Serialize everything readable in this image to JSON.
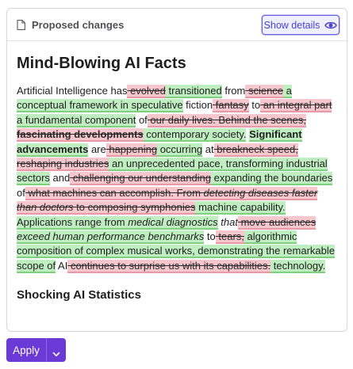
{
  "header": {
    "title": "Proposed changes",
    "show_details_label": "Show details"
  },
  "document": {
    "title": "Mind-Blowing AI Facts",
    "segments": [
      {
        "text": "Artificial Intelligence has",
        "kind": "plain"
      },
      {
        "text": " evolved",
        "kind": "del"
      },
      {
        "text": " transitioned",
        "kind": "ins"
      },
      {
        "text": " from",
        "kind": "plain"
      },
      {
        "text": " science",
        "kind": "del"
      },
      {
        "text": " a conceptual framework in speculative",
        "kind": "ins"
      },
      {
        "text": " fiction",
        "kind": "plain"
      },
      {
        "text": " fantasy",
        "kind": "del"
      },
      {
        "text": " to",
        "kind": "plain"
      },
      {
        "text": " an integral part",
        "kind": "del"
      },
      {
        "text": " a fundamental component",
        "kind": "ins"
      },
      {
        "text": " of",
        "kind": "plain"
      },
      {
        "text": " our daily lives. Behind the scenes, ",
        "kind": "del"
      },
      {
        "text": "fascinating developments",
        "kind": "del",
        "style": "b"
      },
      {
        "text": " contemporary society.",
        "kind": "ins"
      },
      {
        "text": " ",
        "kind": "plain"
      },
      {
        "text": "Significant advancements",
        "kind": "ins",
        "style": "b"
      },
      {
        "text": " are",
        "kind": "plain"
      },
      {
        "text": " happening",
        "kind": "del"
      },
      {
        "text": " occurring",
        "kind": "ins"
      },
      {
        "text": " at",
        "kind": "plain"
      },
      {
        "text": " breakneck speed, reshaping industries",
        "kind": "del"
      },
      {
        "text": " an unprecedented pace, transforming industrial sectors",
        "kind": "ins"
      },
      {
        "text": " and",
        "kind": "plain"
      },
      {
        "text": " challenging our understanding",
        "kind": "del"
      },
      {
        "text": " expanding the boundaries",
        "kind": "ins"
      },
      {
        "text": " of",
        "kind": "plain"
      },
      {
        "text": " what machines can accomplish. From ",
        "kind": "del"
      },
      {
        "text": "detecting diseases faster than doctors",
        "kind": "del",
        "style": "i"
      },
      {
        "text": " to composing symphonies",
        "kind": "del"
      },
      {
        "text": " machine capability. Applications range from ",
        "kind": "ins"
      },
      {
        "text": "medical diagnostics",
        "kind": "ins",
        "style": "i"
      },
      {
        "text": " ",
        "kind": "plain"
      },
      {
        "text": "that",
        "kind": "plain",
        "style": "i"
      },
      {
        "text": " move audiences",
        "kind": "del"
      },
      {
        "text": " ",
        "kind": "plain"
      },
      {
        "text": "exceed human performance benchmarks",
        "kind": "ins",
        "style": "i"
      },
      {
        "text": " to",
        "kind": "plain"
      },
      {
        "text": " tears,",
        "kind": "del"
      },
      {
        "text": " algorithmic composition of complex musical works, demonstrating the remarkable scope of",
        "kind": "ins"
      },
      {
        "text": " AI",
        "kind": "plain"
      },
      {
        "text": " continues to surprise us with its capabilities.",
        "kind": "del"
      },
      {
        "text": " technology.",
        "kind": "ins"
      }
    ],
    "subheading": "Shocking AI Statistics"
  },
  "footer": {
    "apply_label": "Apply"
  },
  "colors": {
    "accent": "#6b39d6",
    "insert_bg": "#bfeec0",
    "delete_bg": "#f6c7cd"
  },
  "icons": [
    "document-icon",
    "eye-icon",
    "chevron-down-icon"
  ]
}
